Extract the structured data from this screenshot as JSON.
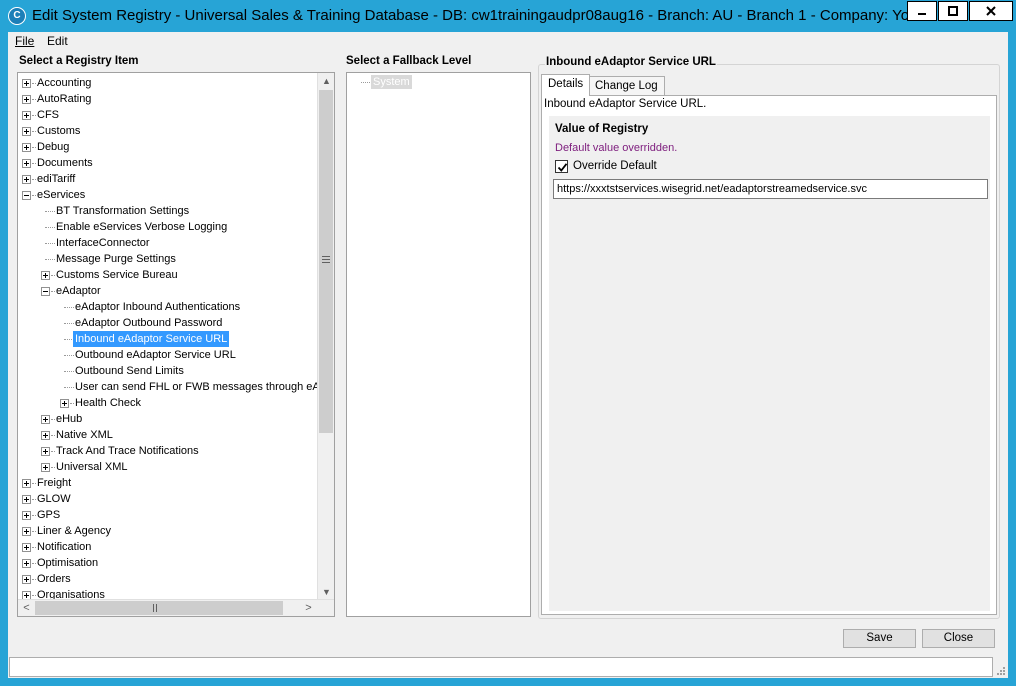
{
  "window": {
    "title": "Edit System Registry - Universal Sales & Training Database - DB: cw1trainingaudpr08aug16 - Branch: AU - Branch 1 - Company: You...",
    "icon": "c-logo-icon",
    "accent_color": "#27a4d6"
  },
  "menu": {
    "file": "File",
    "edit": "Edit"
  },
  "registry_tree": {
    "heading": "Select a Registry Item",
    "items": [
      {
        "label": "Accounting",
        "level": 0,
        "expander": "plus"
      },
      {
        "label": "AutoRating",
        "level": 0,
        "expander": "plus"
      },
      {
        "label": "CFS",
        "level": 0,
        "expander": "plus"
      },
      {
        "label": "Customs",
        "level": 0,
        "expander": "plus"
      },
      {
        "label": "Debug",
        "level": 0,
        "expander": "plus"
      },
      {
        "label": "Documents",
        "level": 0,
        "expander": "plus"
      },
      {
        "label": "ediTariff",
        "level": 0,
        "expander": "plus"
      },
      {
        "label": "eServices",
        "level": 0,
        "expander": "minus"
      },
      {
        "label": "BT Transformation Settings",
        "level": 1,
        "expander": "none"
      },
      {
        "label": "Enable eServices Verbose Logging",
        "level": 1,
        "expander": "none"
      },
      {
        "label": "InterfaceConnector",
        "level": 1,
        "expander": "none"
      },
      {
        "label": "Message Purge Settings",
        "level": 1,
        "expander": "none"
      },
      {
        "label": "Customs Service Bureau",
        "level": 1,
        "expander": "plus"
      },
      {
        "label": "eAdaptor",
        "level": 1,
        "expander": "minus"
      },
      {
        "label": "eAdaptor Inbound Authentications",
        "level": 2,
        "expander": "none"
      },
      {
        "label": "eAdaptor Outbound Password",
        "level": 2,
        "expander": "none"
      },
      {
        "label": "Inbound eAdaptor Service URL",
        "level": 2,
        "expander": "none",
        "selected": true
      },
      {
        "label": "Outbound eAdaptor Service URL",
        "level": 2,
        "expander": "none"
      },
      {
        "label": "Outbound Send Limits",
        "level": 2,
        "expander": "none"
      },
      {
        "label": "User can send FHL or FWB messages through eAd",
        "level": 2,
        "expander": "none"
      },
      {
        "label": "Health Check",
        "level": 2,
        "expander": "plus"
      },
      {
        "label": "eHub",
        "level": 1,
        "expander": "plus"
      },
      {
        "label": "Native XML",
        "level": 1,
        "expander": "plus"
      },
      {
        "label": "Track And Trace Notifications",
        "level": 1,
        "expander": "plus"
      },
      {
        "label": "Universal XML",
        "level": 1,
        "expander": "plus"
      },
      {
        "label": "Freight",
        "level": 0,
        "expander": "plus"
      },
      {
        "label": "GLOW",
        "level": 0,
        "expander": "plus"
      },
      {
        "label": "GPS",
        "level": 0,
        "expander": "plus"
      },
      {
        "label": "Liner & Agency",
        "level": 0,
        "expander": "plus"
      },
      {
        "label": "Notification",
        "level": 0,
        "expander": "plus"
      },
      {
        "label": "Optimisation",
        "level": 0,
        "expander": "plus"
      },
      {
        "label": "Orders",
        "level": 0,
        "expander": "plus"
      },
      {
        "label": "Organisations",
        "level": 0,
        "expander": "plus"
      }
    ]
  },
  "fallback": {
    "heading": "Select a Fallback Level",
    "items": [
      "System"
    ]
  },
  "detail": {
    "group_title": "Inbound eAdaptor Service URL",
    "tabs": [
      "Details",
      "Change Log"
    ],
    "description": "Inbound eAdaptor Service URL.",
    "value_heading": "Value of Registry",
    "override_note": "Default value overridden.",
    "override_label": "Override Default",
    "override_checked": true,
    "url_value": "https://xxxtstservices.wisegrid.net/eadaptorstreamedservice.svc"
  },
  "buttons": {
    "save": "Save",
    "close": "Close"
  },
  "status": {
    "text": ""
  }
}
